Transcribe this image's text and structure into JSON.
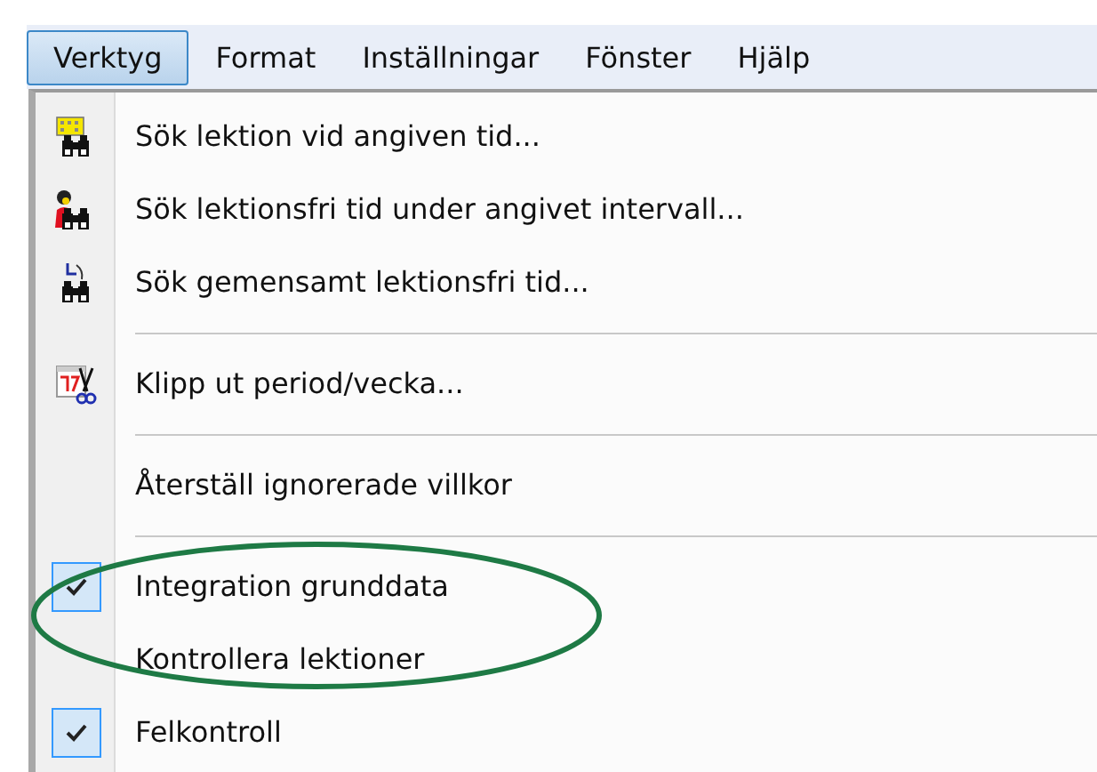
{
  "menubar": [
    {
      "label": "Verktyg",
      "selected": true
    },
    {
      "label": "Format",
      "selected": false
    },
    {
      "label": "Inställningar",
      "selected": false
    },
    {
      "label": "Fönster",
      "selected": false
    },
    {
      "label": "Hjälp",
      "selected": false
    }
  ],
  "menu": {
    "items": [
      {
        "kind": "item",
        "label": "Sök lektion vid angiven tid...",
        "checked": false
      },
      {
        "kind": "item",
        "label": "Sök lektionsfri tid under angivet intervall...",
        "checked": false
      },
      {
        "kind": "item",
        "label": "Sök gemensamt lektionsfri tid...",
        "checked": false
      },
      {
        "kind": "separator"
      },
      {
        "kind": "item",
        "label": "Klipp ut period/vecka...",
        "checked": false
      },
      {
        "kind": "separator"
      },
      {
        "kind": "item",
        "label": "Återställ ignorerade villkor",
        "checked": false
      },
      {
        "kind": "separator"
      },
      {
        "kind": "item",
        "label": "Integration grunddata",
        "checked": true
      },
      {
        "kind": "item",
        "label": "Kontrollera lektioner",
        "checked": false
      },
      {
        "kind": "item",
        "label": "Felkontroll",
        "checked": true
      }
    ]
  }
}
